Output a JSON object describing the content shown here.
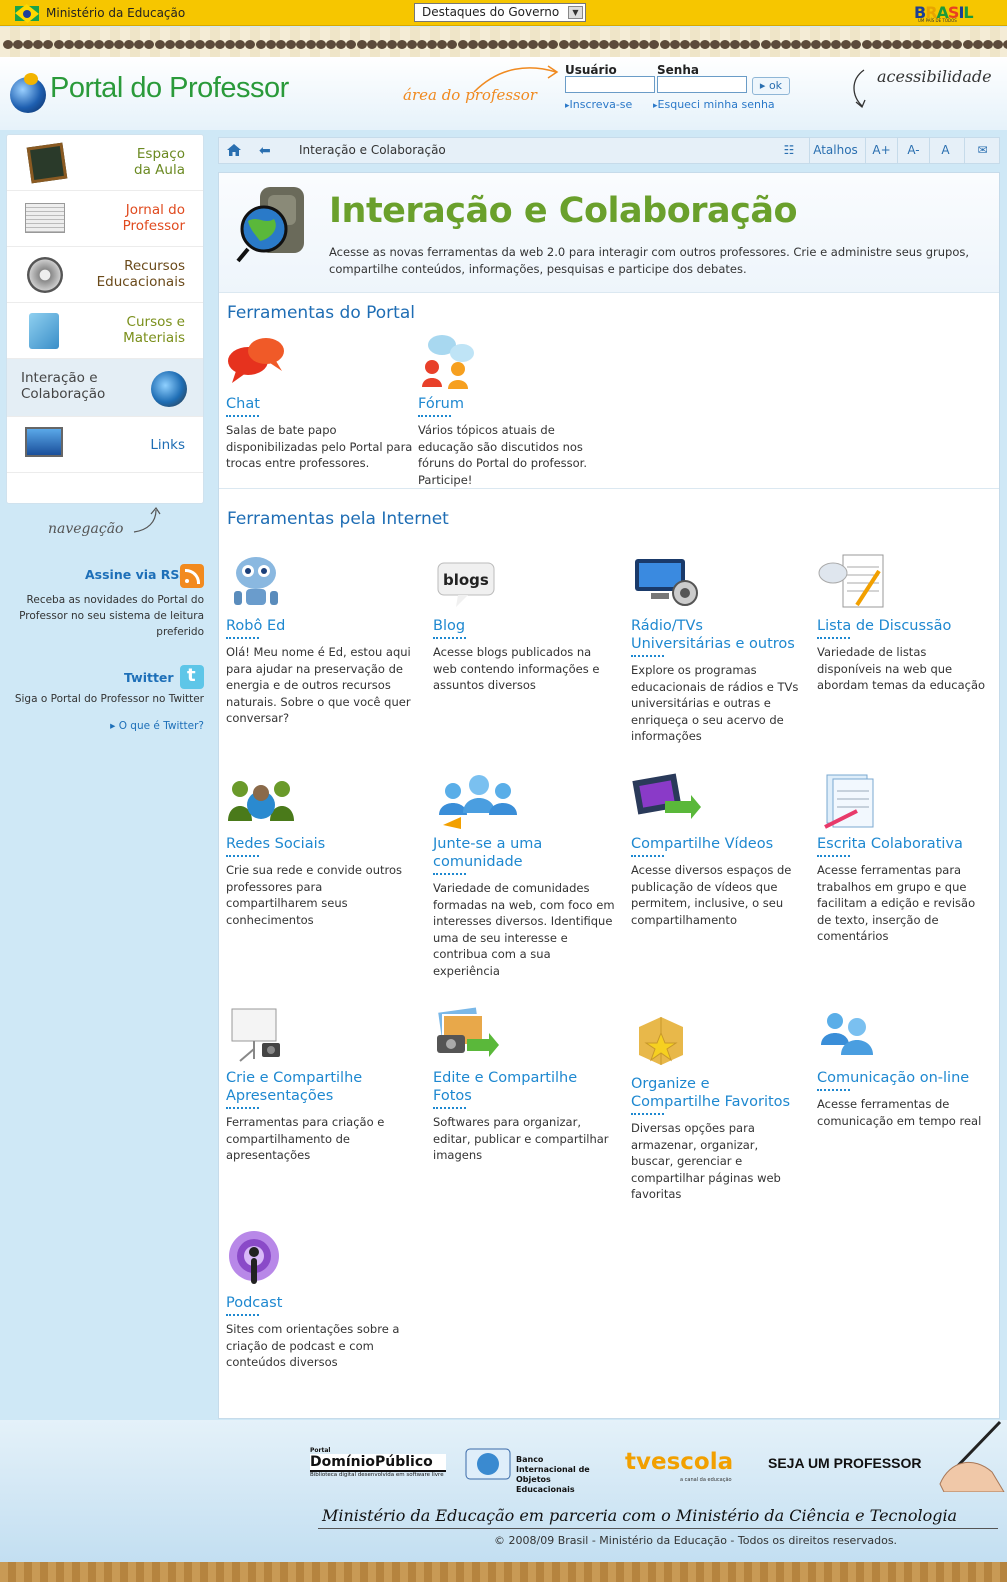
{
  "gov_bar": {
    "ministry": "Ministério da Educação",
    "select_value": "Destaques do Governo",
    "brasil_logo": "BRASIL",
    "brasil_tagline": "UM PAÍS DE TODOS"
  },
  "header": {
    "site_title": "Portal do Professor",
    "area_label": "área do professor",
    "user_label": "Usuário",
    "pass_label": "Senha",
    "ok_label": "ok",
    "signup_link": "Inscreva-se",
    "forgot_link": "Esqueci minha senha",
    "accessibility": "acessibilidade"
  },
  "sidebar": {
    "items": [
      {
        "label": "Espaço da Aula",
        "color": "#6b8a22"
      },
      {
        "label": "Jornal do Professor",
        "color": "#e04a1e"
      },
      {
        "label": "Recursos Educacionais",
        "color": "#6a4a1a"
      },
      {
        "label": "Cursos e Materiais",
        "color": "#7a8f1a"
      },
      {
        "label": "Interação e Colaboração",
        "color": "#444444"
      },
      {
        "label": "Links",
        "color": "#1e6db4"
      }
    ],
    "nav_script": "navegação",
    "rss_title": "Assine via RSS",
    "rss_desc": "Receba as novidades do Portal do Professor no seu sistema de leitura preferido",
    "twitter_title": "Twitter",
    "twitter_desc": "Siga o Portal do Professor no Twitter",
    "twitter_link": "O que é Twitter?"
  },
  "breadcrumb": {
    "current": "Interação e Colaboração",
    "shortcuts": "Atalhos",
    "font_plus": "A+",
    "font_minus": "A-",
    "font_normal": "A"
  },
  "hero": {
    "title": "Interação e Colaboração",
    "desc": "Acesse as novas ferramentas da web 2.0 para interagir com outros professores. Crie e administre seus grupos, compartilhe conteúdos, informações, pesquisas e participe dos debates."
  },
  "portal_tools": {
    "title": "Ferramentas do Portal",
    "items": [
      {
        "title": "Chat",
        "desc": "Salas de bate papo disponibilizadas pelo Portal para trocas entre professores.",
        "icon": "chat-bubbles-icon"
      },
      {
        "title": "Fórum",
        "desc": "Vários tópicos atuais de educação são discutidos nos fóruns do Portal do professor. Participe!",
        "icon": "forum-people-icon"
      }
    ]
  },
  "internet_tools": {
    "title": "Ferramentas pela Internet",
    "items": [
      {
        "title": "Robô Ed",
        "desc": "Olá! Meu nome é Ed, estou aqui para ajudar na preservação de energia e de outros recursos naturais. Sobre o que você quer conversar?",
        "icon": "robot-icon"
      },
      {
        "title": "Blog",
        "desc": "Acesse blogs publicados na web contendo informações e assuntos diversos",
        "icon": "blogs-icon"
      },
      {
        "title": "Rádio/TVs Universitárias e outros",
        "desc": "Explore os programas educacionais de rádios e TVs universitárias e outras e enriqueça o seu acervo de informações",
        "icon": "monitor-speaker-icon"
      },
      {
        "title": "Lista de Discussão",
        "desc": "Variedade de listas disponíveis na web que abordam temas da educação",
        "icon": "document-list-icon"
      },
      {
        "title": "Redes Sociais",
        "desc": "Crie sua rede e convide outros professores para compartilharem seus conhecimentos",
        "icon": "social-network-icon"
      },
      {
        "title": "Junte-se a uma comunidade",
        "desc": "Variedade de comunidades formadas na web, com foco em interesses diversos. Identifique uma de seu interesse e contribua com a sua experiência",
        "icon": "community-icon"
      },
      {
        "title": "Compartilhe Vídeos",
        "desc": "Acesse diversos espaços de publicação de vídeos que permitem, inclusive, o seu compartilhamento",
        "icon": "video-share-icon"
      },
      {
        "title": "Escrita Colaborativa",
        "desc": "Acesse ferramentas para trabalhos em grupo e que facilitam a edição e revisão de texto, inserção de comentários",
        "icon": "collab-writing-icon"
      },
      {
        "title": "Crie e Compartilhe Apresentações",
        "desc": "Ferramentas para criação e compartilhamento de apresentações",
        "icon": "presentation-icon"
      },
      {
        "title": "Edite e Compartilhe Fotos",
        "desc": "Softwares para organizar, editar, publicar e compartilhar imagens",
        "icon": "photo-share-icon"
      },
      {
        "title": "Organize e Compartilhe Favoritos",
        "desc": "Diversas opções para armazenar, organizar, buscar, gerenciar e compartilhar páginas web favoritas",
        "icon": "favorites-box-icon"
      },
      {
        "title": "Comunicação on-line",
        "desc": "Acesse ferramentas de comunicação em tempo real",
        "icon": "online-users-icon"
      },
      {
        "title": "Podcast",
        "desc": "Sites com orientações sobre a criação de podcast e com conteúdos diversos",
        "icon": "podcast-icon"
      }
    ]
  },
  "footer": {
    "logo1_top": "Portal",
    "logo1_main": "DomínioPúblico",
    "logo1_sub": "Biblioteca digital desenvolvida em software livre",
    "logo2": "Banco Internacional de Objetos Educacionais",
    "logo3": "tvescola",
    "logo3_sub": "a canal da educação",
    "logo4": "SEJA UM PROFESSOR",
    "ministry_partner": "Ministério da Educação em parceria com o Ministério da Ciência e Tecnologia",
    "copyright": "© 2008/09 Brasil - Ministério da Educação - Todos os direitos reservados."
  }
}
